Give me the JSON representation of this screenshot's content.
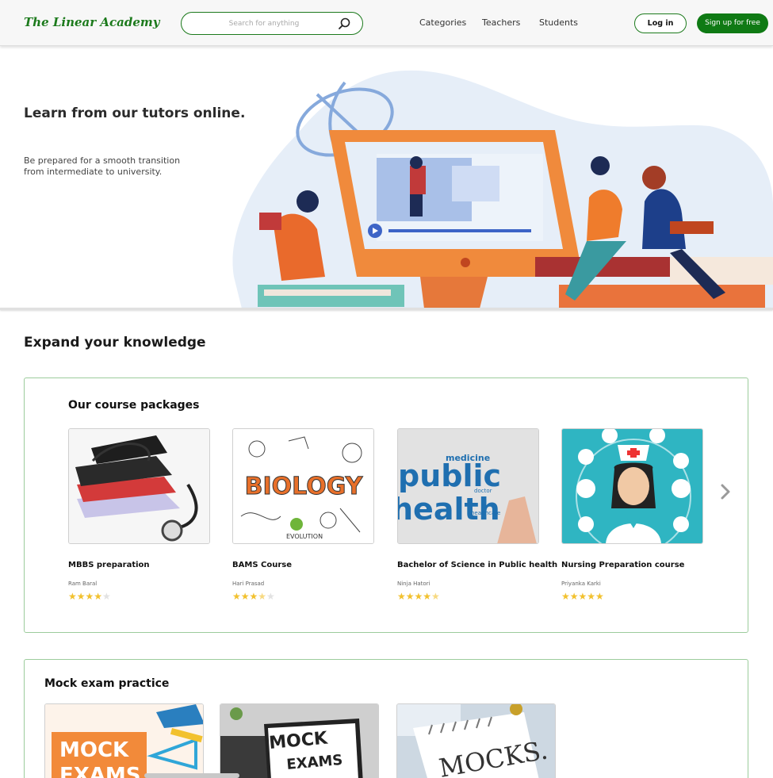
{
  "header": {
    "logo": "The Linear Academy",
    "search_placeholder": "Search for anything",
    "nav": [
      "Categories",
      "Teachers",
      "Students"
    ],
    "login_label": "Log in",
    "signup_label": "Sign up for free",
    "brand_color": "#0f7a14"
  },
  "hero": {
    "title": "Learn from our tutors online.",
    "subtitle_line1": "Be prepared for a smooth transition",
    "subtitle_line2": "from intermediate to university."
  },
  "section_title": "Expand your knowledge",
  "courses": {
    "title": "Our course packages",
    "items": [
      {
        "title": "MBBS preparation",
        "author": "Ram Baral",
        "rating": 4
      },
      {
        "title": "BAMS Course",
        "author": "Hari Prasad",
        "rating": 3.5
      },
      {
        "title": "Bachelor of Science in Public health",
        "author": "Ninja Hatori",
        "rating": 4.5
      },
      {
        "title": "Nursing Preparation course",
        "author": "Priyanka Karki",
        "rating": 5
      }
    ],
    "image_texts": [
      "BIOLOGY",
      "EVOLUTION",
      "public",
      "health",
      "medicine",
      "healthcare",
      "doctor"
    ]
  },
  "mock": {
    "title": "Mock exam practice",
    "image_texts": [
      "MOCK",
      "EXAMS",
      "MOCK",
      "EXAMS",
      "MOCKS."
    ]
  }
}
